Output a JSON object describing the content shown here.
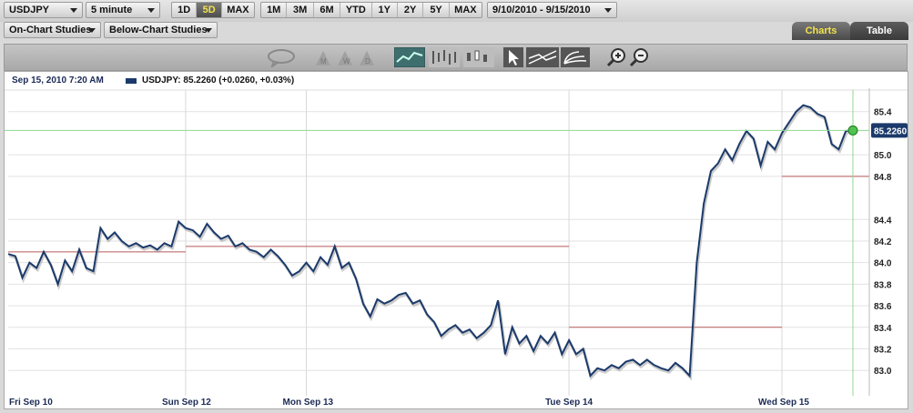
{
  "toolbar": {
    "symbol": "USDJPY",
    "interval": "5 minute",
    "range_short": [
      "1D",
      "5D",
      "MAX"
    ],
    "range_short_active": "5D",
    "range_long": [
      "1M",
      "3M",
      "6M",
      "YTD",
      "1Y",
      "2Y",
      "5Y",
      "MAX"
    ],
    "date_range": "9/10/2010 - 9/15/2010"
  },
  "studies": {
    "on_chart": "On-Chart Studies",
    "below_chart": "Below-Chart Studies"
  },
  "tabs": {
    "charts": "Charts",
    "table": "Table",
    "active": "Charts"
  },
  "icons": [
    "speech-bubble-icon",
    "event-markers-icon",
    "line-chart-icon",
    "ohlc-chart-icon",
    "candlestick-chart-icon",
    "pointer-icon",
    "trendline-icon",
    "fibonacci-icon",
    "zoom-in-icon",
    "zoom-out-icon"
  ],
  "info": {
    "datetime": "Sep 15, 2010 7:20 AM",
    "series_text": "USDJPY: 85.2260 (+0.0260, +0.03%)"
  },
  "colors": {
    "line": "#1b3a6b",
    "prev_close": "#b85a5a",
    "last_price_line": "#8fd88f",
    "price_tag_bg": "#1b3a6b"
  },
  "chart_data": {
    "type": "line",
    "series": [
      {
        "name": "USDJPY"
      }
    ],
    "ylim": [
      82.85,
      85.6
    ],
    "yticks": [
      "85.4",
      "85.0",
      "84.8",
      "84.4",
      "84.2",
      "84.0",
      "83.8",
      "83.6",
      "83.4",
      "83.2",
      "83.0"
    ],
    "xlabels": [
      "Fri Sep 10",
      "Sun Sep 12",
      "Mon Sep 13",
      "Tue Sep 14",
      "Wed Sep 15"
    ],
    "last_price": "85.2260",
    "last_value": 85.226,
    "prev_close_levels": [
      {
        "session": "Fri Sep 10",
        "value": 84.1
      },
      {
        "session": "Mon Sep 13",
        "value": 84.15
      },
      {
        "session": "Tue Sep 14",
        "value": 83.4
      },
      {
        "session": "Wed Sep 15",
        "value": 84.8
      }
    ],
    "y_values": [
      84.08,
      84.06,
      83.86,
      84.0,
      83.95,
      84.1,
      83.98,
      83.8,
      84.02,
      83.92,
      84.12,
      83.95,
      83.92,
      84.32,
      84.22,
      84.28,
      84.2,
      84.15,
      84.18,
      84.14,
      84.16,
      84.12,
      84.18,
      84.15,
      84.38,
      84.32,
      84.3,
      84.24,
      84.36,
      84.28,
      84.22,
      84.25,
      84.15,
      84.18,
      84.12,
      84.1,
      84.05,
      84.12,
      84.06,
      83.98,
      83.88,
      83.92,
      84.0,
      83.92,
      84.05,
      83.98,
      84.15,
      83.95,
      84.0,
      83.85,
      83.62,
      83.5,
      83.66,
      83.62,
      83.65,
      83.7,
      83.72,
      83.62,
      83.65,
      83.52,
      83.45,
      83.32,
      83.38,
      83.42,
      83.35,
      83.38,
      83.3,
      83.35,
      83.42,
      83.65,
      83.15,
      83.4,
      83.25,
      83.32,
      83.18,
      83.32,
      83.25,
      83.35,
      83.15,
      83.28,
      83.15,
      83.2,
      82.95,
      83.02,
      83.0,
      83.05,
      83.02,
      83.08,
      83.1,
      83.05,
      83.1,
      83.05,
      83.02,
      83.0,
      83.07,
      83.02,
      82.95,
      84.0,
      84.55,
      84.85,
      84.92,
      85.05,
      84.95,
      85.1,
      85.22,
      85.15,
      84.9,
      85.12,
      85.05,
      85.2,
      85.3,
      85.4,
      85.46,
      85.44,
      85.38,
      85.35,
      85.1,
      85.05,
      85.22,
      85.226
    ]
  }
}
